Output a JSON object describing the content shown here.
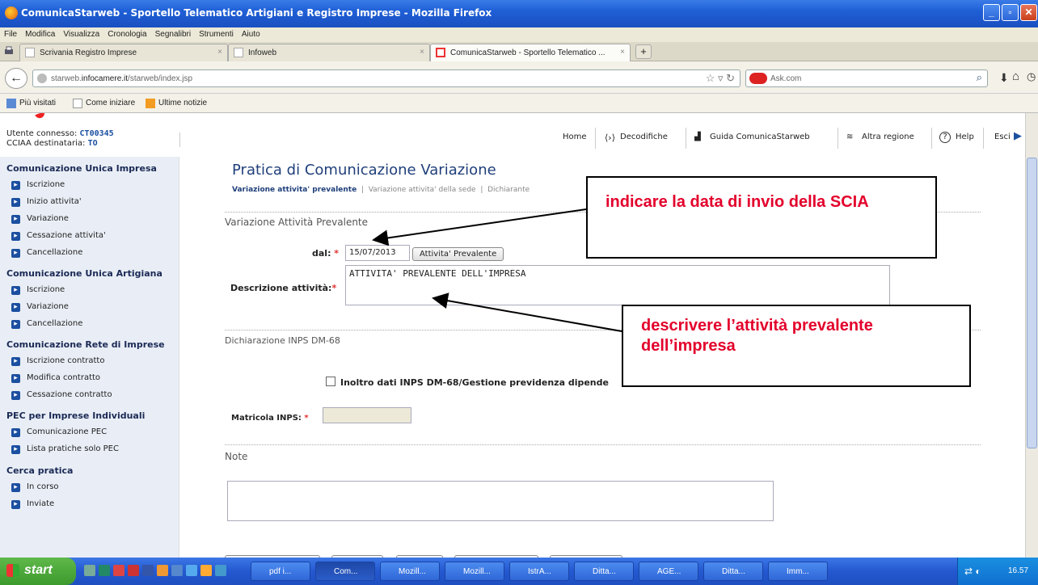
{
  "window": {
    "title": "ComunicaStarweb - Sportello Telematico Artigiani e Registro Imprese - Mozilla Firefox"
  },
  "menubar": [
    "File",
    "Modifica",
    "Visualizza",
    "Cronologia",
    "Segnalibri",
    "Strumenti",
    "Aiuto"
  ],
  "tabs": [
    {
      "label": "Scrivania Registro Imprese"
    },
    {
      "label": "Infoweb"
    },
    {
      "label": "ComunicaStarweb - Sportello Telematico ..."
    }
  ],
  "nav": {
    "url_domain": "starweb.",
    "url_host": "infocamere.it",
    "url_path": "/starweb/index.jsp",
    "search_placeholder": "Ask.com"
  },
  "bookmarks": [
    "Più visitati",
    "Come iniziare",
    "Ultime notizie"
  ],
  "user": {
    "connected_label": "Utente connesso:",
    "connected_value": "CT00345",
    "cciaa_label": "CCIAA destinataria:",
    "cciaa_value": "TO"
  },
  "topnav": [
    "Home",
    "Decodifiche",
    "Guida ComunicaStarweb",
    "Altra regione",
    "Help",
    "Esci"
  ],
  "sidebar": {
    "sections": [
      {
        "title": "Comunicazione Unica Impresa",
        "items": [
          "Iscrizione",
          "Inizio attivita'",
          "Variazione",
          "Cessazione attivita'",
          "Cancellazione"
        ]
      },
      {
        "title": "Comunicazione Unica Artigiana",
        "items": [
          "Iscrizione",
          "Variazione",
          "Cancellazione"
        ]
      },
      {
        "title": "Comunicazione Rete di Imprese",
        "items": [
          "Iscrizione contratto",
          "Modifica contratto",
          "Cessazione contratto"
        ]
      },
      {
        "title": "PEC per Imprese Individuali",
        "items": [
          "Comunicazione PEC",
          "Lista pratiche solo PEC"
        ]
      },
      {
        "title": "Cerca pratica",
        "items": [
          "In corso",
          "Inviate"
        ]
      }
    ]
  },
  "main": {
    "title": "Pratica di Comunicazione Variazione",
    "steps": {
      "active": "Variazione attivita' prevalente",
      "s2": "Variazione attivita' della sede",
      "s3": "Dichiarante"
    },
    "sec1": "Variazione Attività Prevalente",
    "dal_label": "dal:",
    "dal_value": "15/07/2013",
    "btn_attivita": "Attivita' Prevalente",
    "desc_label": "Descrizione attività:",
    "desc_value": "ATTIVITA' PREVALENTE DELL'IMPRESA",
    "sec2": "Dichiarazione INPS DM-68",
    "inps_check": "Inoltro dati INPS DM-68/Gestione previdenza dipende",
    "matricola_label": "Matricola INPS:",
    "sec3": "Note"
  },
  "annotations": {
    "a1": "indicare la data di invio della SCIA",
    "a2": "descrivere l’attività prevalente dell’impresa"
  },
  "taskbar": {
    "start": "start",
    "tasks": [
      "pdf i...",
      "Com...",
      "Mozill...",
      "Mozill...",
      "IstrA...",
      "Ditta...",
      "AGE...",
      "Ditta...",
      "Imm..."
    ],
    "clock": "16.57"
  },
  "colors": {
    "accent": "#1f3f7a",
    "annotation": "#e3002b",
    "required": "#e03030"
  }
}
